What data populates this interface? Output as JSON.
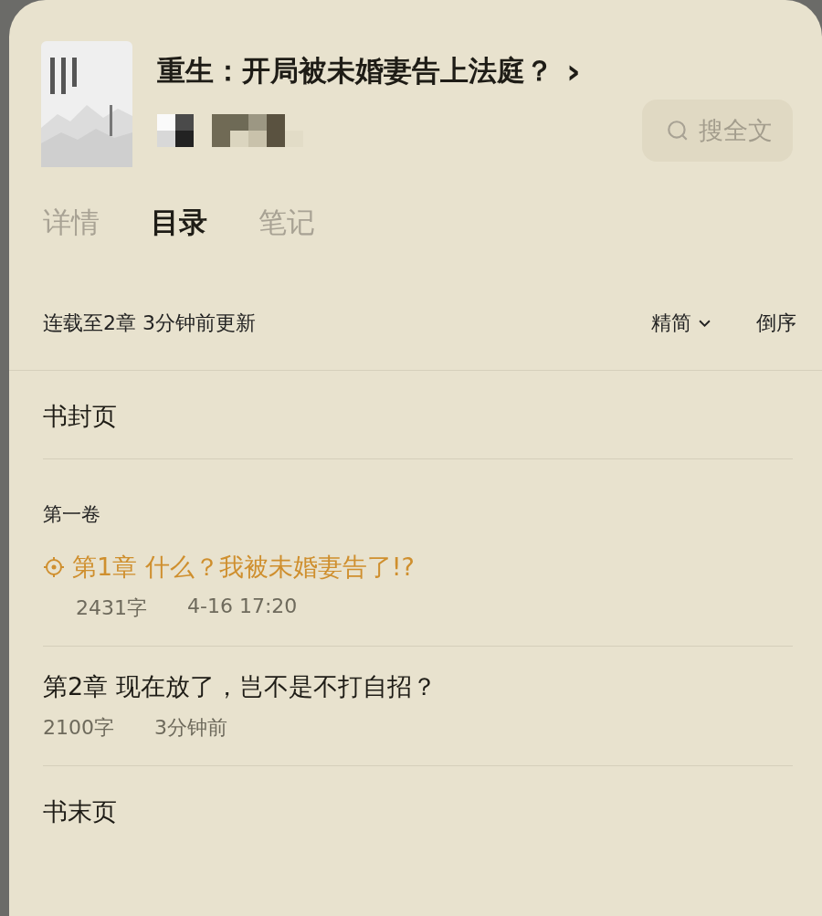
{
  "book": {
    "title": "重生：开局被未婚妻告上法庭？",
    "chevron": "›"
  },
  "search": {
    "label": "搜全文"
  },
  "tabs": [
    {
      "label": "详情",
      "selected": false
    },
    {
      "label": "目录",
      "selected": true
    },
    {
      "label": "笔记",
      "selected": false
    }
  ],
  "toolbar": {
    "status": "连载至2章 3分钟前更新",
    "filter": "精简",
    "order": "倒序"
  },
  "toc": [
    {
      "kind": "page",
      "title": "书封页"
    },
    {
      "kind": "volume",
      "title": "第一卷"
    },
    {
      "kind": "chapter",
      "title": "第1章 什么？我被未婚妻告了!?",
      "current": true,
      "words": "2431字",
      "time": "4-16 17:20"
    },
    {
      "kind": "chapter",
      "title": "第2章 现在放了，岂不是不打自招？",
      "current": false,
      "words": "2100字",
      "time": "3分钟前"
    },
    {
      "kind": "page",
      "title": "书末页"
    }
  ]
}
